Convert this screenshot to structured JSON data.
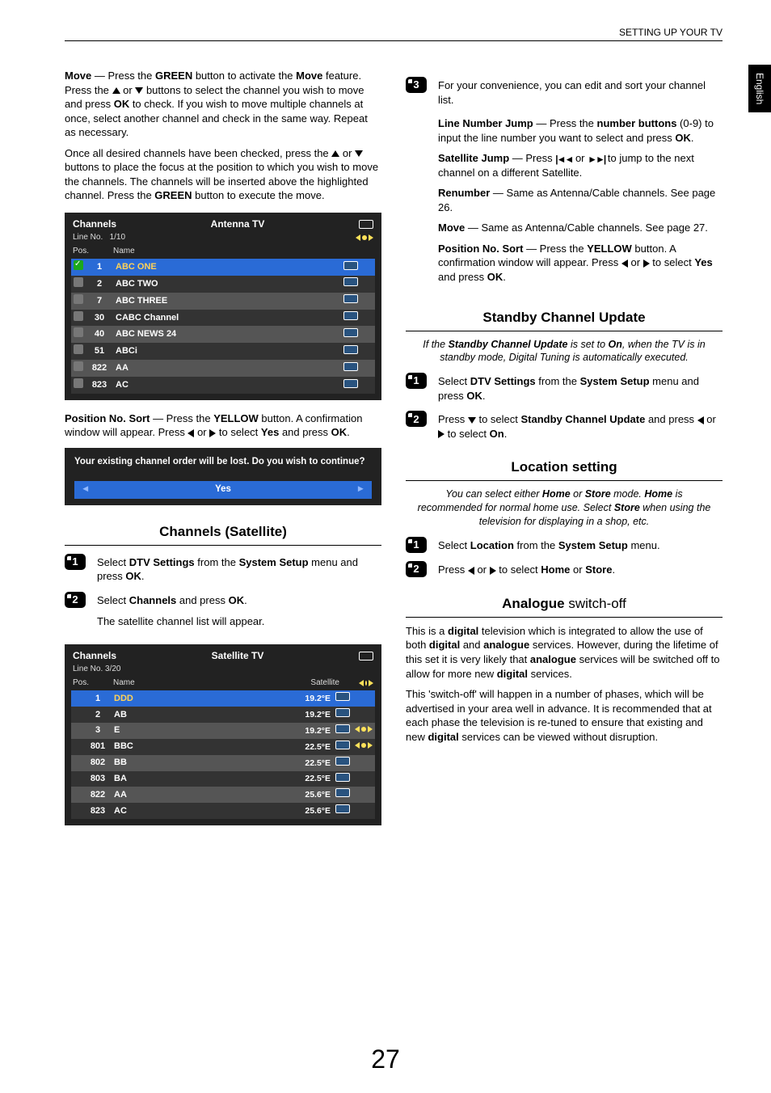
{
  "header": {
    "section": "SETTING UP YOUR TV",
    "lang": "English"
  },
  "page_number": "27",
  "left": {
    "move_para1_parts": [
      "Move",
      " — Press the ",
      "GREEN",
      " button to activate the ",
      "Move",
      " feature. Press the ",
      " or ",
      " buttons to select the channel you wish to move and press ",
      "OK",
      " to check. If you wish to move multiple channels at once, select another channel and check in the same way. Repeat as necessary."
    ],
    "move_para2_parts": [
      "Once all desired channels have been checked, press the ",
      " or ",
      " buttons to place the focus at the position to which you wish to move the channels. The channels will be inserted above the highlighted channel. Press the ",
      "GREEN",
      " button to execute the move."
    ],
    "osd1": {
      "title": "Channels",
      "mode": "Antenna TV",
      "line_label": "Line No.",
      "line_val": "1/10",
      "head_pos": "Pos.",
      "head_name": "Name",
      "rows": [
        {
          "pos": "1",
          "name": "ABC ONE",
          "sel": true
        },
        {
          "pos": "2",
          "name": "ABC TWO"
        },
        {
          "pos": "7",
          "name": "ABC THREE"
        },
        {
          "pos": "30",
          "name": "CABC Channel"
        },
        {
          "pos": "40",
          "name": "ABC NEWS 24"
        },
        {
          "pos": "51",
          "name": "ABCi"
        },
        {
          "pos": "822",
          "name": "AA"
        },
        {
          "pos": "823",
          "name": "AC"
        }
      ]
    },
    "pos_sort_parts": [
      "Position No. Sort",
      " — Press the ",
      "YELLOW",
      " button. A confirmation window will appear. Press ",
      " or ",
      " to select ",
      "Yes",
      " and press ",
      "OK",
      "."
    ],
    "confirm": {
      "msg": "Your existing channel order will be lost. Do you wish to continue?",
      "yes": "Yes"
    },
    "sat_title": "Channels (Satellite)",
    "sat_step1_parts": [
      "Select ",
      "DTV Settings",
      " from the ",
      "System Setup",
      " menu and press ",
      "OK",
      "."
    ],
    "sat_step2_parts": [
      "Select ",
      "Channels",
      " and press ",
      "OK",
      "."
    ],
    "sat_note": "The  satellite channel list will appear.",
    "osd2": {
      "title": "Channels",
      "mode": "Satellite TV",
      "line_label": "Line No. 3/20",
      "head_pos": "Pos.",
      "head_name": "Name",
      "head_sat": "Satellite",
      "rows": [
        {
          "pos": "1",
          "name": "DDD",
          "sat": "19.2°E",
          "sel": true
        },
        {
          "pos": "2",
          "name": "AB",
          "sat": "19.2°E"
        },
        {
          "pos": "3",
          "name": "E",
          "sat": "19.2°E",
          "key": true
        },
        {
          "pos": "801",
          "name": "BBC",
          "sat": "22.5°E",
          "key": true
        },
        {
          "pos": "802",
          "name": "BB",
          "sat": "22.5°E"
        },
        {
          "pos": "803",
          "name": "BA",
          "sat": "22.5°E"
        },
        {
          "pos": "822",
          "name": "AA",
          "sat": "25.6°E"
        },
        {
          "pos": "823",
          "name": "AC",
          "sat": "25.6°E"
        }
      ]
    }
  },
  "right": {
    "step3_a": "For your convenience, you can edit and sort your channel list.",
    "lnj_parts": [
      "Line Number Jump",
      " — Press the ",
      "number buttons",
      " (0-9) to input the line number you want to select and press ",
      "OK",
      "."
    ],
    "sj_parts": [
      "Satellite Jump",
      " — Press ",
      " or ",
      " to jump to the next channel on a different Satellite."
    ],
    "renum_parts": [
      "Renumber",
      " — Same as Antenna/Cable channels. See page 26."
    ],
    "move_parts": [
      "Move",
      " — Same as Antenna/Cable channels. See page 27."
    ],
    "pns_parts": [
      "Position No. Sort",
      " — Press the ",
      "YELLOW",
      " button. A confirmation window will appear. Press ",
      " or ",
      " to select ",
      "Yes",
      " and press ",
      "OK",
      "."
    ],
    "standby": {
      "title": "Standby Channel Update",
      "blurb_parts": [
        "If the ",
        "Standby Channel Update",
        " is set to ",
        "On",
        ", when the TV is in standby mode, Digital Tuning is automatically executed."
      ],
      "s1_parts": [
        "Select ",
        "DTV Settings",
        " from the ",
        "System Setup",
        " menu and press ",
        "OK",
        "."
      ],
      "s2_parts": [
        "Press ",
        " to select ",
        "Standby Channel Update",
        " and press ",
        " or ",
        " to select ",
        "On",
        "."
      ]
    },
    "location": {
      "title": "Location setting",
      "blurb_parts": [
        "You can select either ",
        "Home",
        " or ",
        "Store",
        " mode. ",
        "Home",
        " is recommended for normal home use. Select ",
        "Store",
        " when using the television for displaying in a shop, etc."
      ],
      "s1_parts": [
        "Select ",
        "Location",
        " from the ",
        "System Setup",
        " menu."
      ],
      "s2_parts": [
        "Press ",
        " or ",
        " to select ",
        "Home",
        " or ",
        "Store",
        "."
      ]
    },
    "analogue": {
      "title_prefix": "Analogue",
      "title_suffix": " switch-off",
      "p1_parts": [
        "This is a ",
        "digital",
        " television which is integrated to allow the use of both ",
        "digital",
        " and ",
        "analogue",
        " services. However, during the lifetime of this set it is very likely that ",
        "analogue",
        " services will be switched off to allow for more new ",
        "digital",
        " services."
      ],
      "p2_parts": [
        "This 'switch-off' will happen in a number of phases, which will be advertised in your area well in advance. It is recommended that at each phase the television is re-tuned to ensure that existing and new ",
        "digital",
        " services can be viewed without disruption."
      ]
    }
  }
}
